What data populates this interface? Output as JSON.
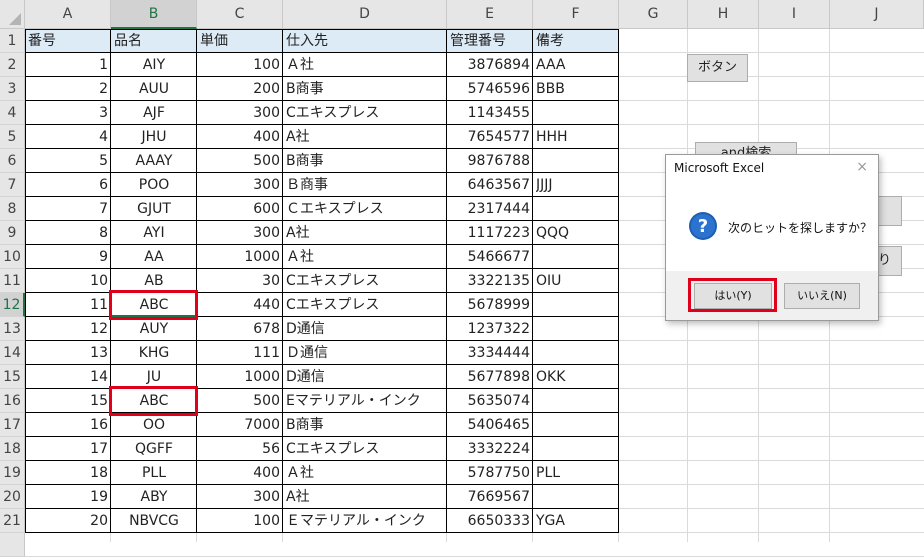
{
  "columns": [
    "A",
    "B",
    "C",
    "D",
    "E",
    "F",
    "G",
    "H",
    "I",
    "J"
  ],
  "selected_column": "B",
  "rows": [
    "1",
    "2",
    "3",
    "4",
    "5",
    "6",
    "7",
    "8",
    "9",
    "10",
    "11",
    "12",
    "13",
    "14",
    "15",
    "16",
    "17",
    "18",
    "19",
    "20",
    "21"
  ],
  "selected_row": "12",
  "table": {
    "headers": [
      "番号",
      "品名",
      "単価",
      "仕入先",
      "管理番号",
      "備考"
    ],
    "data": [
      [
        "1",
        "AIY",
        "100",
        "Ａ社",
        "3876894",
        "AAA"
      ],
      [
        "2",
        "AUU",
        "200",
        "B商事",
        "5746596",
        "BBB"
      ],
      [
        "3",
        "AJF",
        "300",
        "Cエキスプレス",
        "1143455",
        ""
      ],
      [
        "4",
        "JHU",
        "400",
        "A社",
        "7654577",
        "HHH"
      ],
      [
        "5",
        "AAAY",
        "500",
        "B商事",
        "9876788",
        ""
      ],
      [
        "6",
        "POO",
        "300",
        "Ｂ商事",
        "6463567",
        "JJJJ"
      ],
      [
        "7",
        "GJUT",
        "600",
        "Ｃエキスプレス",
        "2317444",
        ""
      ],
      [
        "8",
        "AYI",
        "300",
        "A社",
        "1117223",
        "QQQ"
      ],
      [
        "9",
        "AA",
        "1000",
        "Ａ社",
        "5466677",
        ""
      ],
      [
        "10",
        "AB",
        "30",
        "Cエキスプレス",
        "3322135",
        "OIU"
      ],
      [
        "11",
        "ABC",
        "440",
        "Cエキスプレス",
        "5678999",
        ""
      ],
      [
        "12",
        "AUY",
        "678",
        "D通信",
        "1237322",
        ""
      ],
      [
        "13",
        "KHG",
        "111",
        "Ｄ通信",
        "3334444",
        ""
      ],
      [
        "14",
        "JU",
        "1000",
        "D通信",
        "5677898",
        "OKK"
      ],
      [
        "15",
        "ABC",
        "500",
        "Eマテリアル・インク",
        "5635074",
        ""
      ],
      [
        "16",
        "OO",
        "7000",
        "B商事",
        "5406465",
        ""
      ],
      [
        "17",
        "QGFF",
        "56",
        "Cエキスプレス",
        "3332224",
        ""
      ],
      [
        "18",
        "PLL",
        "400",
        "Ａ社",
        "5787750",
        "PLL"
      ],
      [
        "19",
        "ABY",
        "300",
        "A社",
        "7669567",
        ""
      ],
      [
        "20",
        "NBVCG",
        "100",
        "Ｅマテリアル・インク",
        "6650333",
        "YGA"
      ]
    ]
  },
  "sheet_buttons": {
    "button1": "ボタン",
    "button2_partial": "and検索",
    "button3_partial": "り"
  },
  "dialog": {
    "title": "Microsoft Excel",
    "close": "×",
    "message": "次のヒットを探しますか？",
    "yes": "はい(Y)",
    "no": "いいえ(N)"
  },
  "colors": {
    "header_fill": "#ddebf7",
    "highlight_red": "#e0001b",
    "excel_green": "#217346"
  }
}
